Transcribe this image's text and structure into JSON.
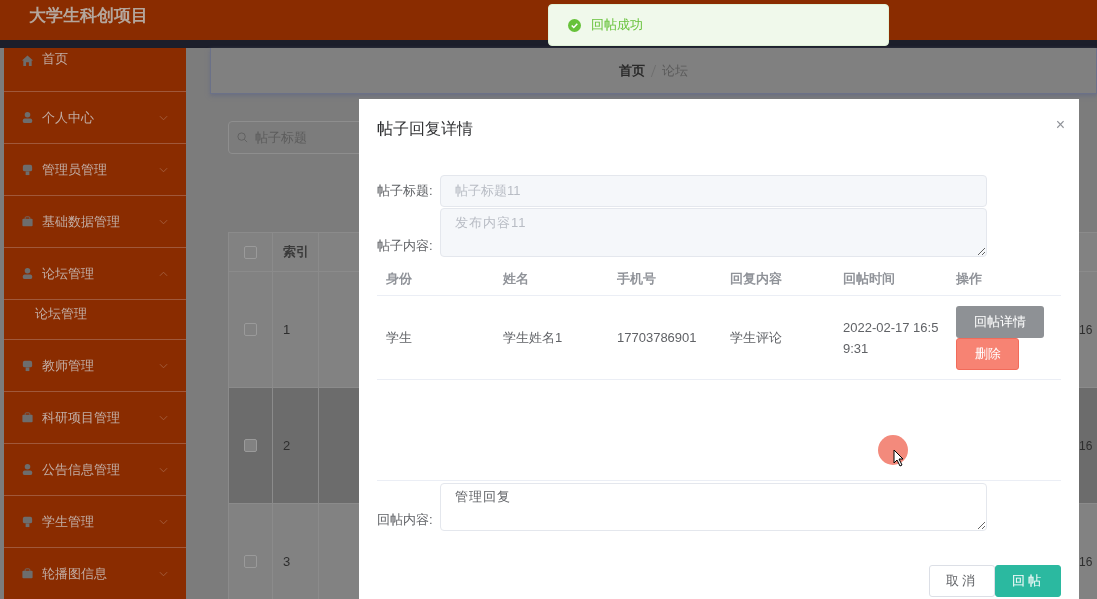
{
  "app_title": "大学生科创项目",
  "toast": {
    "message": "回帖成功"
  },
  "sidebar": {
    "items": [
      {
        "label": "首页",
        "kind": "link"
      },
      {
        "label": "个人中心",
        "kind": "menu",
        "expanded": false
      },
      {
        "label": "管理员管理",
        "kind": "menu",
        "expanded": false
      },
      {
        "label": "基础数据管理",
        "kind": "menu",
        "expanded": false
      },
      {
        "label": "论坛管理",
        "kind": "menu",
        "expanded": true,
        "children": [
          {
            "label": "论坛管理"
          }
        ]
      },
      {
        "label": "教师管理",
        "kind": "menu",
        "expanded": false
      },
      {
        "label": "科研项目管理",
        "kind": "menu",
        "expanded": false
      },
      {
        "label": "公告信息管理",
        "kind": "menu",
        "expanded": false
      },
      {
        "label": "学生管理",
        "kind": "menu",
        "expanded": false
      },
      {
        "label": "轮播图信息",
        "kind": "menu",
        "expanded": false
      }
    ]
  },
  "breadcrumb": [
    "首页",
    "论坛"
  ],
  "search": {
    "placeholder": "帖子标题"
  },
  "table": {
    "header_checked": false,
    "columns": [
      "索引"
    ],
    "rows": [
      {
        "checked": false,
        "highlighted": false,
        "index": "1",
        "column_3": "16"
      },
      {
        "checked": false,
        "highlighted": true,
        "index": "2",
        "column_3": "16"
      },
      {
        "checked": false,
        "highlighted": false,
        "index": "3",
        "column_3": "16"
      }
    ]
  },
  "dialog": {
    "title": "帖子回复详情",
    "close": "×",
    "fields": [
      {
        "kind": "input",
        "label": "帖子标题:",
        "value": "帖子标题11",
        "disabled": true
      },
      {
        "kind": "textarea",
        "label": "帖子内容:",
        "value": "发布内容11",
        "disabled": true
      }
    ],
    "replies": {
      "columns": [
        "身份",
        "姓名",
        "手机号",
        "回复内容",
        "回帖时间",
        "操作"
      ],
      "rows": [
        {
          "identity": "学生",
          "name": "学生姓名1",
          "phone": "17703786901",
          "content": "学生评论",
          "time": "2022-02-17 16:59:31",
          "actions": [
            {
              "kind": "detail",
              "label": "回帖详情"
            },
            {
              "kind": "delete",
              "label": "删除"
            }
          ]
        }
      ]
    },
    "reply": {
      "label": "回帖内容:",
      "value": "管理回复"
    },
    "buttons": [
      {
        "kind": "cancel",
        "label": "取消"
      },
      {
        "kind": "primary",
        "label": "回帖"
      }
    ]
  }
}
